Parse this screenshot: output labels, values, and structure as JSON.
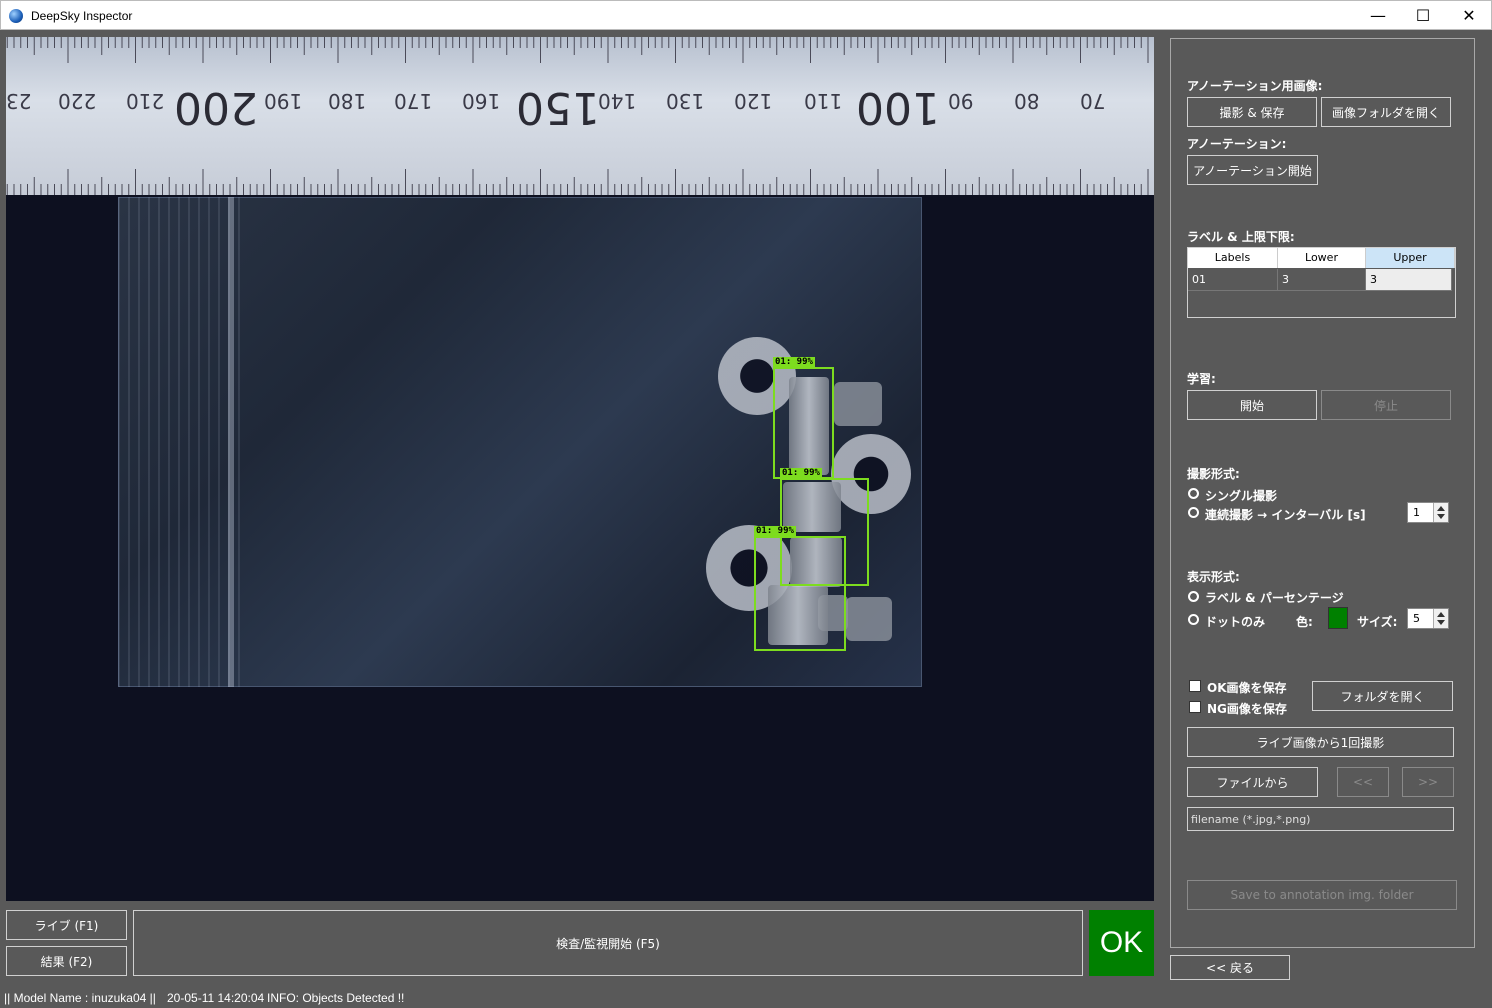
{
  "window": {
    "title": "DeepSky Inspector",
    "min_glyph": "—",
    "max_glyph": "☐",
    "close_glyph": "✕"
  },
  "camera": {
    "ruler_numbers": [
      "23",
      "220",
      "210",
      "200",
      "190",
      "180",
      "170",
      "160",
      "150",
      "140",
      "130",
      "120",
      "110",
      "100",
      "90",
      "80",
      "70"
    ],
    "detections": [
      {
        "label": "01: 99%"
      },
      {
        "label": "01: 99%"
      },
      {
        "label": "01: 99%"
      }
    ],
    "accent_color": "#7ddc1f"
  },
  "bottom": {
    "live_label": "ライブ (F1)",
    "result_label": "結果 (F2)",
    "inspect_label": "検査/監視開始 (F5)",
    "result_status": "OK",
    "result_color": "#008000"
  },
  "panel": {
    "annotation_image_heading": "アノーテーション用画像:",
    "capture_save_label": "撮影 & 保存",
    "open_image_folder_label": "画像フォルダを開く",
    "annotation_heading": "アノーテーション:",
    "start_annotation_label": "アノーテーション開始",
    "label_limits_heading": "ラベル & 上限下限:",
    "table": {
      "headers": [
        "Labels",
        "Lower",
        "Upper"
      ],
      "rows": [
        [
          "01",
          "3",
          "3"
        ]
      ]
    },
    "learning_heading": "学習:",
    "learning_start_label": "開始",
    "learning_stop_label": "停止",
    "capture_mode_heading": "撮影形式:",
    "capture_single_label": "シングル撮影",
    "capture_continuous_label": "連続撮影 → インターバル [s]",
    "interval_value": "1",
    "display_mode_heading": "表示形式:",
    "display_label_pct": "ラベル & パーセンテージ",
    "display_dot_only": "ドットのみ",
    "color_label": "色:",
    "dot_color": "#008000",
    "size_label": "サイズ:",
    "size_value": "5",
    "save_ok_label": "OK画像を保存",
    "save_ng_label": "NG画像を保存",
    "open_folder_label": "フォルダを開く",
    "capture_once_label": "ライブ画像から1回撮影",
    "from_file_label": "ファイルから",
    "prev_label": "<<",
    "next_label": ">>",
    "filename_placeholder": "filename (*.jpg,*.png)",
    "save_annotation_label": "Save to annotation img. folder",
    "back_label": "<< 戻る"
  },
  "status": {
    "model": "|| Model Name : inuzuka04 ||",
    "time": "20-05-11 14:20:04",
    "info": "INFO:   Objects Detected !!"
  }
}
